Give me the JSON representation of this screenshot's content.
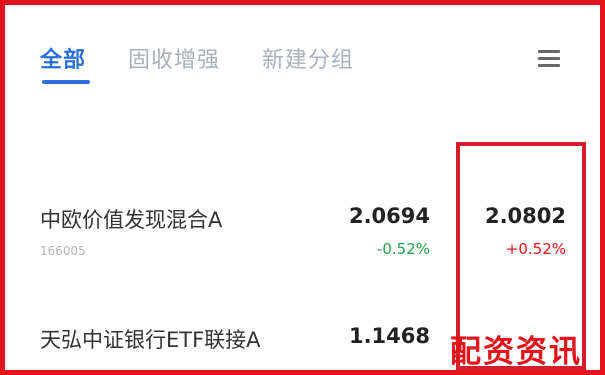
{
  "tabs": [
    {
      "label": "全部",
      "active": true
    },
    {
      "label": "固收增强",
      "active": false
    },
    {
      "label": "新建分组",
      "active": false
    }
  ],
  "menu_icon": "list-menu-icon",
  "funds": [
    {
      "name": "中欧价值发现混合A",
      "code": "166005",
      "nav": "2.0694",
      "nav_change": "-0.52%",
      "estimate": "2.0802",
      "estimate_change": "+0.52%"
    },
    {
      "name": "天弘中证银行ETF联接A",
      "code": "",
      "nav": "1.1468",
      "nav_change": "",
      "estimate": "",
      "estimate_change": ""
    }
  ],
  "watermark": "配资资讯",
  "colors": {
    "accent": "#2a6fd6",
    "up": "#e3141b",
    "down": "#1fa34a",
    "frame": "#e3141b"
  }
}
